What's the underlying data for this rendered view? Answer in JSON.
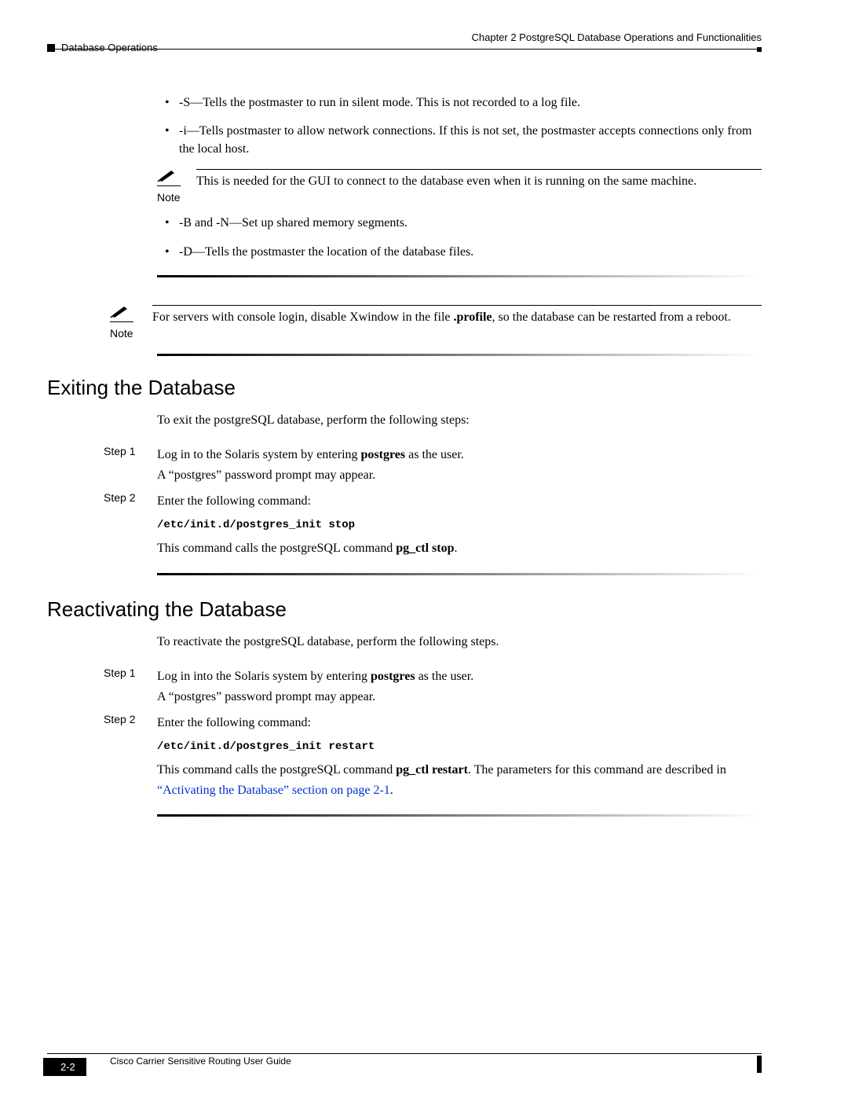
{
  "header": {
    "chapter": "Chapter 2      PostgreSQL Database Operations and Functionalities",
    "section": "Database Operations"
  },
  "bullets_top": [
    "-S—Tells the postmaster to run in silent mode. This is not recorded to a log file.",
    "-i—Tells postmaster to allow network connections. If this is not set, the postmaster accepts connections only from the local host."
  ],
  "note1": {
    "label": "Note",
    "text": "This is needed for the GUI to connect to the database even when it is running on the same machine."
  },
  "bullets_mid": [
    "-B and -N—Set up shared memory segments.",
    "-D—Tells the postmaster the location of the database files."
  ],
  "note2": {
    "label": "Note",
    "text_pre": "For servers with console login, disable Xwindow in the file ",
    "bold": ".profile",
    "text_post": ", so the database can be restarted from a reboot."
  },
  "exiting": {
    "heading": "Exiting the Database",
    "intro": "To exit the postgreSQL database, perform the following steps:",
    "step1_label": "Step 1",
    "step1_pre": "Log in to the Solaris system by entering ",
    "step1_bold": "postgres",
    "step1_post": " as the user.",
    "step1_line2": "A “postgres” password prompt may appear.",
    "step2_label": "Step 2",
    "step2_text": "Enter the following command:",
    "step2_cmd": "/etc/init.d/postgres_init stop",
    "step2_after_pre": "This command calls the postgreSQL command ",
    "step2_after_bold": "pg_ctl stop",
    "step2_after_post": "."
  },
  "reactivating": {
    "heading": "Reactivating the Database",
    "intro": "To reactivate the postgreSQL database, perform the following steps.",
    "step1_label": "Step 1",
    "step1_pre": "Log in into the Solaris system by entering ",
    "step1_bold": "postgres",
    "step1_post": " as the user.",
    "step1_line2": "A “postgres” password prompt may appear.",
    "step2_label": "Step 2",
    "step2_text": "Enter the following command:",
    "step2_cmd": "/etc/init.d/postgres_init restart",
    "step2_after_pre": "This command calls the postgreSQL command ",
    "step2_after_bold": "pg_ctl restart",
    "step2_after_mid": ". The parameters for this command are described in ",
    "step2_link": "“Activating the Database” section on page 2-1",
    "step2_after_post": "."
  },
  "footer": {
    "guide": "Cisco Carrier Sensitive Routing User Guide",
    "page": "2-2"
  }
}
